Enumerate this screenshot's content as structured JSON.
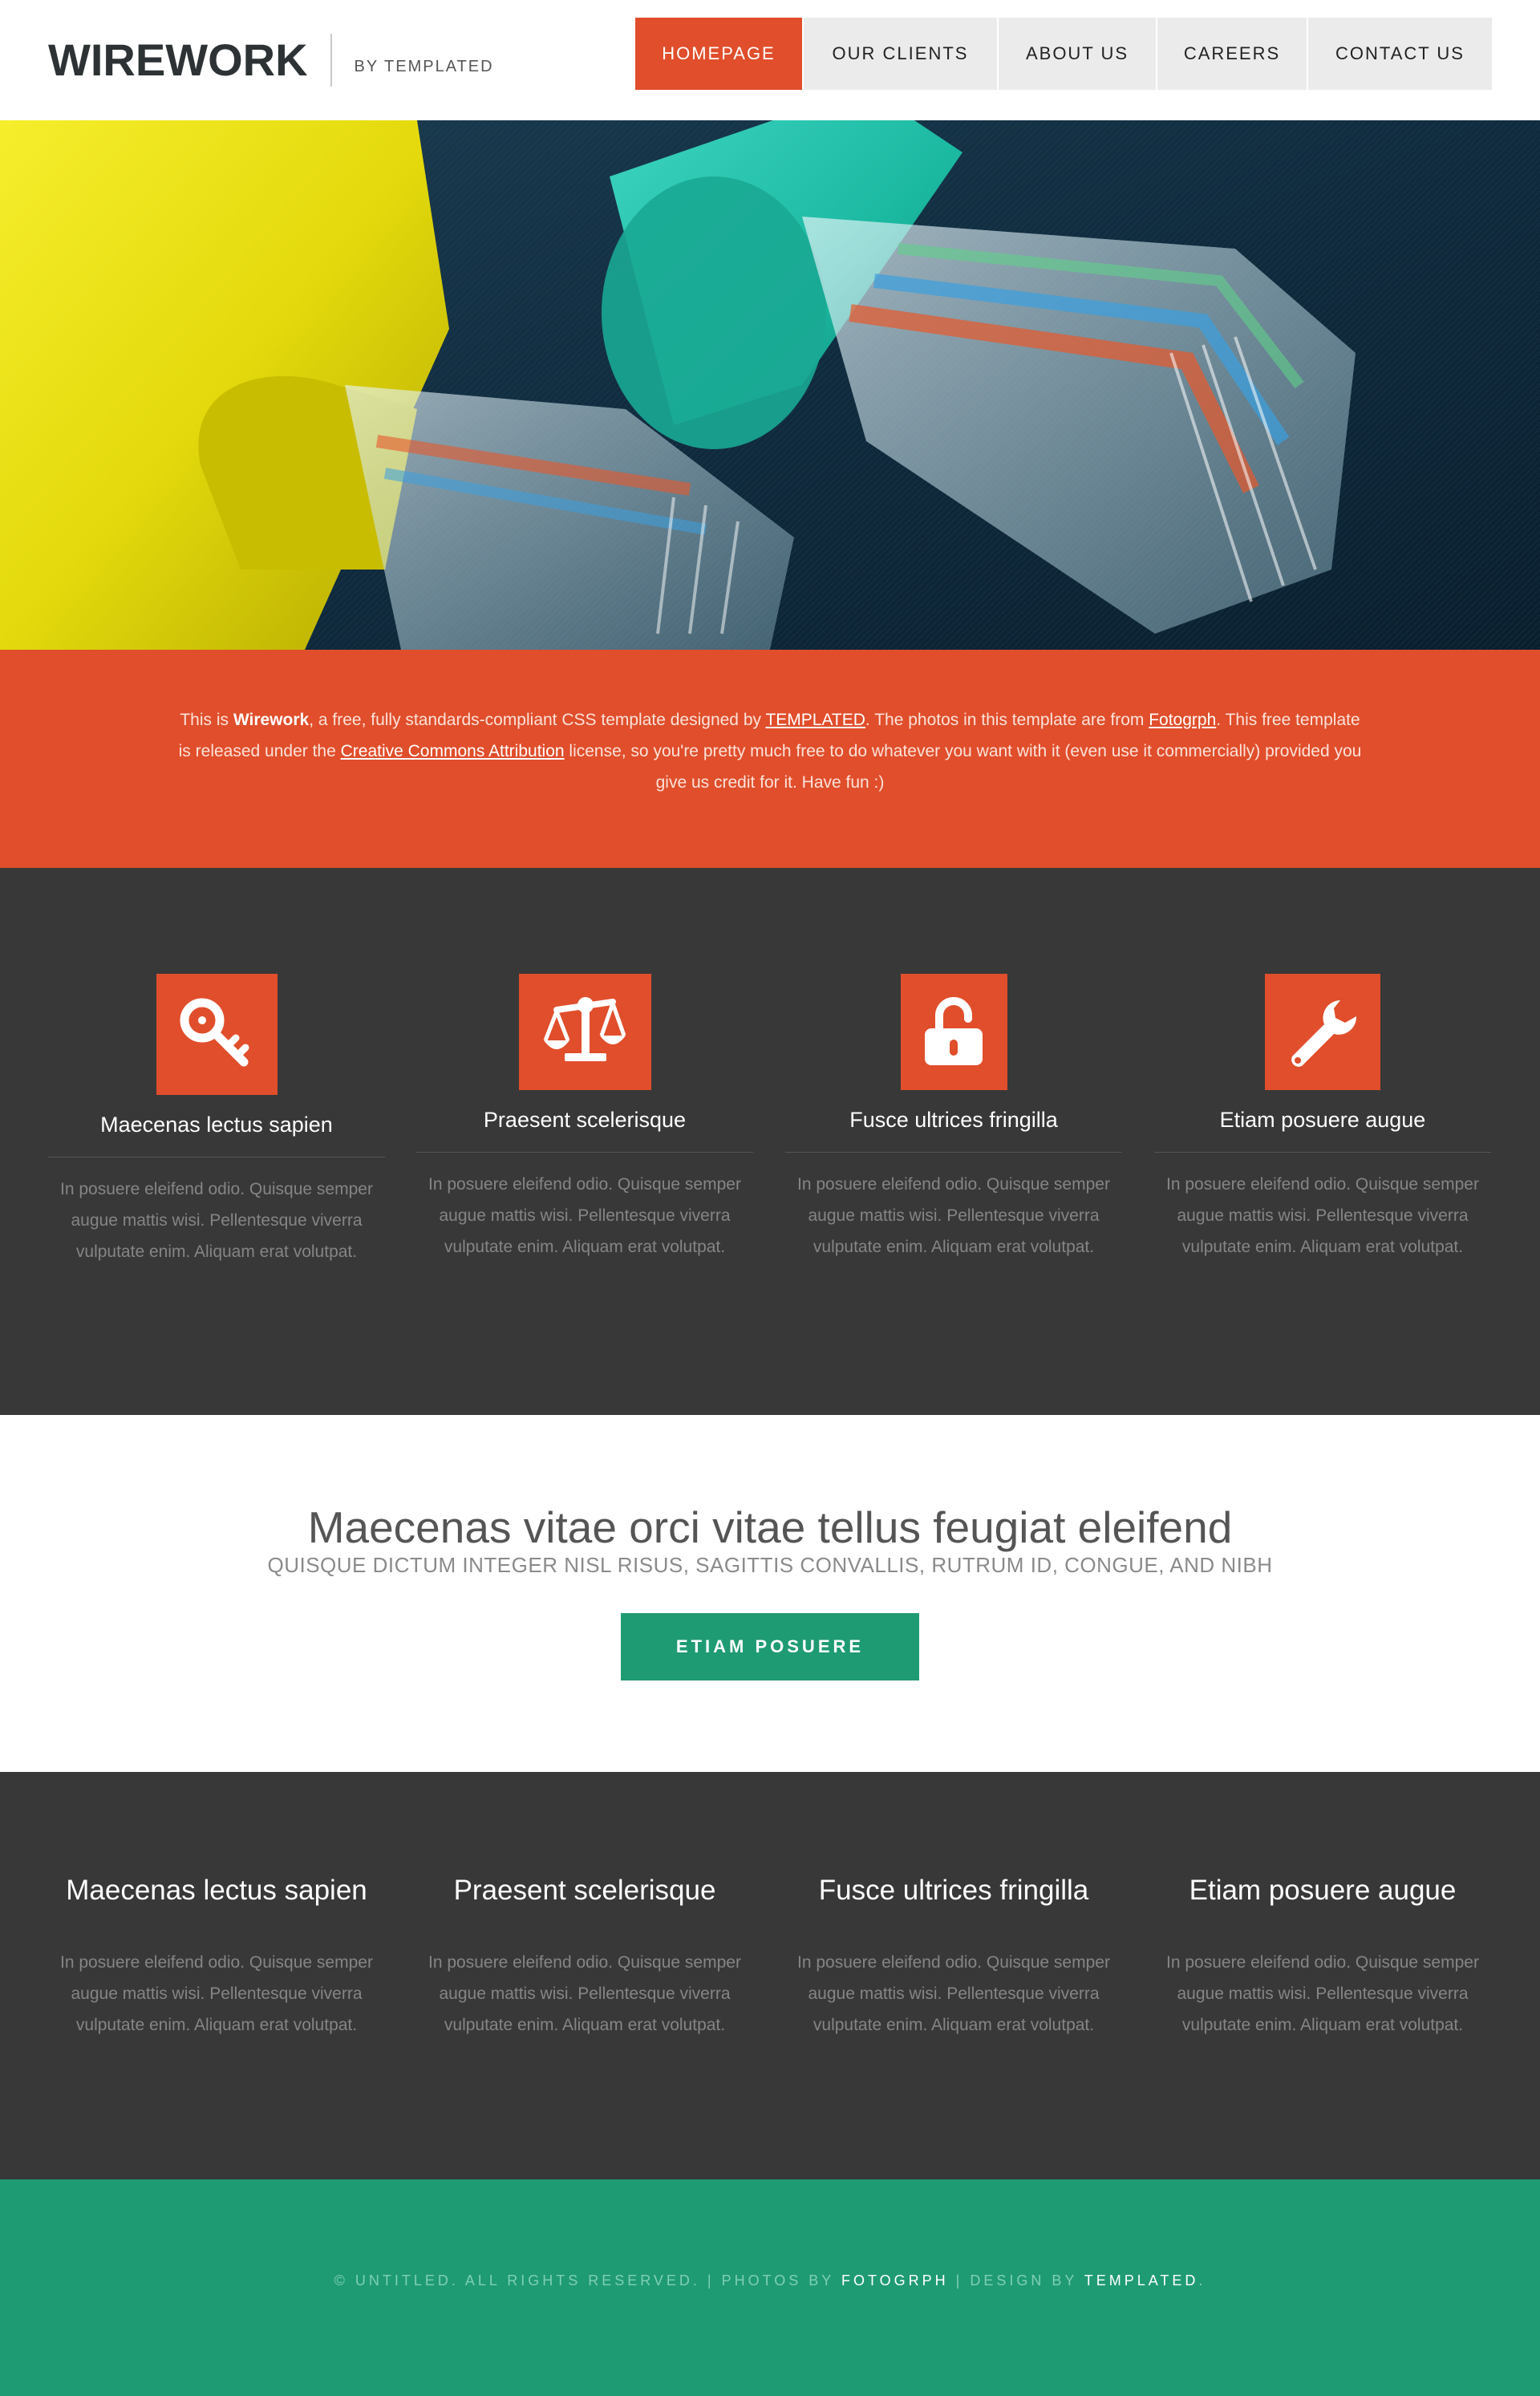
{
  "header": {
    "logo": "WIREWORK",
    "tagline": "BY TEMPLATED",
    "nav": [
      {
        "label": "HOMEPAGE",
        "active": true
      },
      {
        "label": "OUR CLIENTS",
        "active": false
      },
      {
        "label": "ABOUT US",
        "active": false
      },
      {
        "label": "CAREERS",
        "active": false
      },
      {
        "label": "CONTACT US",
        "active": false
      }
    ]
  },
  "hero": {
    "image": "network-cables-photo"
  },
  "intro": {
    "p1": "This is ",
    "brand": "Wirework",
    "p2": ", a free, fully standards-compliant CSS template designed by ",
    "link1": "TEMPLATED",
    "p3": ". The photos in this template are from ",
    "link2": "Fotogrph",
    "p4": ". This free template is released under the ",
    "link3": "Creative Commons Attribution",
    "p5": " license, so you're pretty much free to do whatever you want with it (even use it commercially) provided you give us credit for it. Have fun :)"
  },
  "features": [
    {
      "icon": "key-icon",
      "title": "Maecenas lectus sapien",
      "text": "In posuere eleifend odio. Quisque semper augue mattis wisi. Pellentesque viverra vulputate enim. Aliquam erat volutpat."
    },
    {
      "icon": "scale-icon",
      "title": "Praesent scelerisque",
      "text": "In posuere eleifend odio. Quisque semper augue mattis wisi. Pellentesque viverra vulputate enim. Aliquam erat volutpat."
    },
    {
      "icon": "unlock-icon",
      "title": "Fusce ultrices fringilla",
      "text": "In posuere eleifend odio. Quisque semper augue mattis wisi. Pellentesque viverra vulputate enim. Aliquam erat volutpat."
    },
    {
      "icon": "wrench-icon",
      "title": "Etiam posuere augue",
      "text": "In posuere eleifend odio. Quisque semper augue mattis wisi. Pellentesque viverra vulputate enim. Aliquam erat volutpat."
    }
  ],
  "cta": {
    "title": "Maecenas vitae orci vitae tellus feugiat eleifend",
    "subtitle": "QUISQUE DICTUM INTEGER NISL RISUS, SAGITTIS CONVALLIS, RUTRUM ID, CONGUE, AND NIBH",
    "button": "ETIAM POSUERE"
  },
  "columns": [
    {
      "title": "Maecenas lectus sapien",
      "text": "In posuere eleifend odio. Quisque semper augue mattis wisi. Pellentesque viverra vulputate enim. Aliquam erat volutpat."
    },
    {
      "title": "Praesent scelerisque",
      "text": "In posuere eleifend odio. Quisque semper augue mattis wisi. Pellentesque viverra vulputate enim. Aliquam erat volutpat."
    },
    {
      "title": "Fusce ultrices fringilla",
      "text": "In posuere eleifend odio. Quisque semper augue mattis wisi. Pellentesque viverra vulputate enim. Aliquam erat volutpat."
    },
    {
      "title": "Etiam posuere augue",
      "text": "In posuere eleifend odio. Quisque semper augue mattis wisi. Pellentesque viverra vulputate enim. Aliquam erat volutpat."
    }
  ],
  "footer": {
    "copyright": "© UNTITLED. ALL RIGHTS RESERVED. | PHOTOS BY ",
    "photos_link": "FOTOGRPH",
    "sep": " | DESIGN BY ",
    "design_link": "TEMPLATED",
    "end": "."
  },
  "colors": {
    "accent": "#e04e2b",
    "dark": "#383838",
    "green": "#1f9b73"
  }
}
